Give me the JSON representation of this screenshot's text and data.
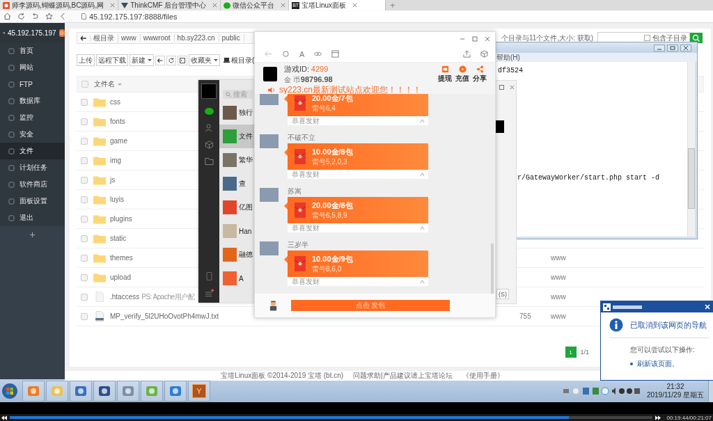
{
  "browser": {
    "tabs": [
      {
        "title": "师李源码,蝴蝶源码,BC源码,网",
        "selected": false
      },
      {
        "title": "ThinkCMF 后台管理中心",
        "selected": false
      },
      {
        "title": "微信公众平台",
        "selected": false
      },
      {
        "title": "宝塔Linux面板",
        "selected": true,
        "favicon_text": "BT"
      }
    ],
    "new_tab": "+",
    "address": "45.192.175.197:8888/files"
  },
  "sidebar": {
    "host": "45.192.175.197",
    "badge": "0",
    "items": [
      {
        "label": "首页",
        "selected": false
      },
      {
        "label": "网站",
        "selected": false
      },
      {
        "label": "FTP",
        "selected": false
      },
      {
        "label": "数据库",
        "selected": false
      },
      {
        "label": "监控",
        "selected": false
      },
      {
        "label": "安全",
        "selected": false
      },
      {
        "label": "文件",
        "selected": true
      },
      {
        "label": "计划任务",
        "selected": false
      },
      {
        "label": "软件商店",
        "selected": false
      },
      {
        "label": "面板设置",
        "selected": false
      },
      {
        "label": "退出",
        "selected": false
      }
    ],
    "add": "+"
  },
  "breadcrumb": [
    "根目录",
    "www",
    "wwwroot",
    "hb.sy223.cn",
    "public"
  ],
  "summary": "个目录与11个文件,大小: 获取)",
  "search": {
    "checkbox_label": "包含子目录",
    "checked": false
  },
  "toolbar": {
    "left": [
      {
        "label": "上传",
        "dropdown": false
      },
      {
        "label": "远程下载",
        "dropdown": false
      },
      {
        "label": "新建",
        "dropdown": true
      }
    ],
    "right": [
      {
        "label": "收藏夹",
        "dropdown": true
      }
    ],
    "root_label": "根目录("
  },
  "table": {
    "header": "文件名",
    "all_checked": false,
    "rows": [
      {
        "kind": "folder",
        "name": "css",
        "checked": false
      },
      {
        "kind": "folder",
        "name": "fonts",
        "checked": false
      },
      {
        "kind": "folder",
        "name": "game",
        "checked": false
      },
      {
        "kind": "folder",
        "name": "img",
        "checked": false
      },
      {
        "kind": "folder",
        "name": "js",
        "checked": false
      },
      {
        "kind": "folder",
        "name": "luyis",
        "checked": false
      },
      {
        "kind": "folder",
        "name": "plugins",
        "checked": false
      },
      {
        "kind": "folder",
        "name": "static",
        "checked": false
      },
      {
        "kind": "folder",
        "name": "themes",
        "owner": "www",
        "checked": false
      },
      {
        "kind": "folder",
        "name": "upload",
        "owner": "www",
        "checked": false
      },
      {
        "kind": "file",
        "name": ".htaccess",
        "note": "PS: Apache用户配",
        "owner": "www",
        "checked": false
      },
      {
        "kind": "text-file",
        "name": "MP_verify_5l2UHoOvotPh4mwJ.txt",
        "permission": "755",
        "owner": "www",
        "checked": false
      }
    ]
  },
  "pagination": {
    "pages": [
      {
        "label": "1",
        "selected": true
      }
    ],
    "summary": "1/1"
  },
  "footer": [
    "宝塔Linux面板 ©2014-2019 宝塔 (bt.cn)",
    "问题求助|产品建议请上宝塔论坛",
    "《使用手册》"
  ],
  "cmd_window": {
    "menu": "帮助(H)",
    "lines": [
      "df3524",
      "r/GatewayWorker/start.php start -d"
    ]
  },
  "back_chat_window": {
    "send_button": "(S)"
  },
  "wechat": {
    "search_placeholder": "搜索",
    "contacts": [
      {
        "name": "独行",
        "selected": false
      },
      {
        "name": "文件",
        "selected": true
      },
      {
        "name": "繁华",
        "selected": false
      },
      {
        "name": "查",
        "selected": false
      },
      {
        "name": "亿图",
        "selected": false
      },
      {
        "name": "Han",
        "selected": false
      },
      {
        "name": "融德",
        "selected": false
      },
      {
        "name": "A",
        "selected": false
      }
    ]
  },
  "game_window": {
    "toolbar_text": "A",
    "game_id_label": "游戏ID:",
    "game_id": "4299",
    "coins_label": "金 币",
    "coins": "98796.98",
    "actions": [
      "提现",
      "充值",
      "分享"
    ],
    "marquee": "sy223.cn最新测试站点欢迎您！！！！",
    "messages": [
      {
        "amount": "20.00金/7包",
        "mines": "雷号6,4",
        "greeting": "恭喜发财"
      },
      {
        "name": "不破不立",
        "amount": "10.00金/8包",
        "mines": "雷号5,2,0,3",
        "greeting": "恭喜发财"
      },
      {
        "name": "苏嵩",
        "amount": "20.00金/8包",
        "mines": "雷号6,5,8,9",
        "greeting": "恭喜发财"
      },
      {
        "name": "三岁半",
        "amount": "10.00金/9包",
        "mines": "雷号8,6,0",
        "greeting": "恭喜发财"
      }
    ],
    "send_button": "点击 发包"
  },
  "notification": {
    "message": "已取消到该网页的导航",
    "hint": "您可以尝试以下操作:",
    "actions": [
      "刷新该页面。"
    ]
  },
  "taskbar": {
    "app_letter": "Y",
    "time": "21:32",
    "date": "2019/11/29 星期五"
  },
  "player": {
    "level": 0.87,
    "time": "00:19:44/00:21:07"
  }
}
